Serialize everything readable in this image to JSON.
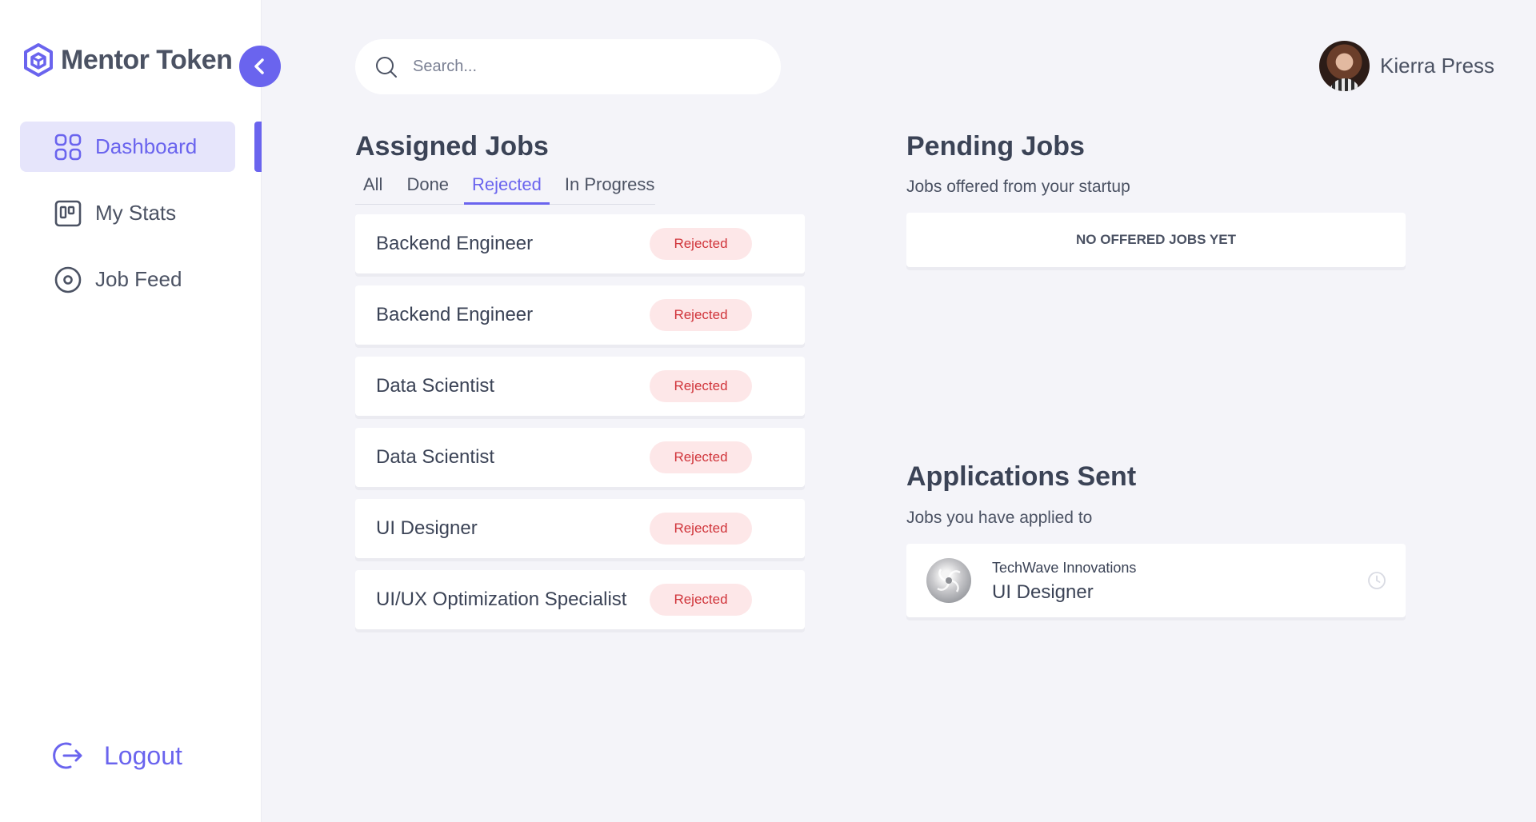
{
  "brand": {
    "name": "Mentor Token",
    "accent": "#6a64ee"
  },
  "sidebar": {
    "items": [
      {
        "label": "Dashboard",
        "icon": "dashboard-grid-icon",
        "active": true
      },
      {
        "label": "My Stats",
        "icon": "stats-board-icon",
        "active": false
      },
      {
        "label": "Job Feed",
        "icon": "target-circle-icon",
        "active": false
      }
    ],
    "logout_label": "Logout"
  },
  "header": {
    "search_placeholder": "Search...",
    "user_name": "Kierra Press"
  },
  "assigned_jobs": {
    "title": "Assigned Jobs",
    "tabs": [
      "All",
      "Done",
      "Rejected",
      "In Progress"
    ],
    "active_tab": "Rejected",
    "jobs": [
      {
        "title": "Backend Engineer",
        "status": "Rejected"
      },
      {
        "title": "Backend Engineer",
        "status": "Rejected"
      },
      {
        "title": "Data Scientist",
        "status": "Rejected"
      },
      {
        "title": "Data Scientist",
        "status": "Rejected"
      },
      {
        "title": "UI Designer",
        "status": "Rejected"
      },
      {
        "title": "UI/UX Optimization Specialist",
        "status": "Rejected"
      }
    ]
  },
  "pending_jobs": {
    "title": "Pending Jobs",
    "subtitle": "Jobs offered from your startup",
    "empty_text": "NO OFFERED JOBS YET"
  },
  "applications": {
    "title": "Applications Sent",
    "subtitle": "Jobs you have applied to",
    "items": [
      {
        "company": "TechWave Innovations",
        "role": "UI Designer"
      }
    ]
  },
  "colors": {
    "rejected_text": "#d0343a",
    "rejected_bg": "#fde7e8",
    "background": "#f4f4f9"
  }
}
